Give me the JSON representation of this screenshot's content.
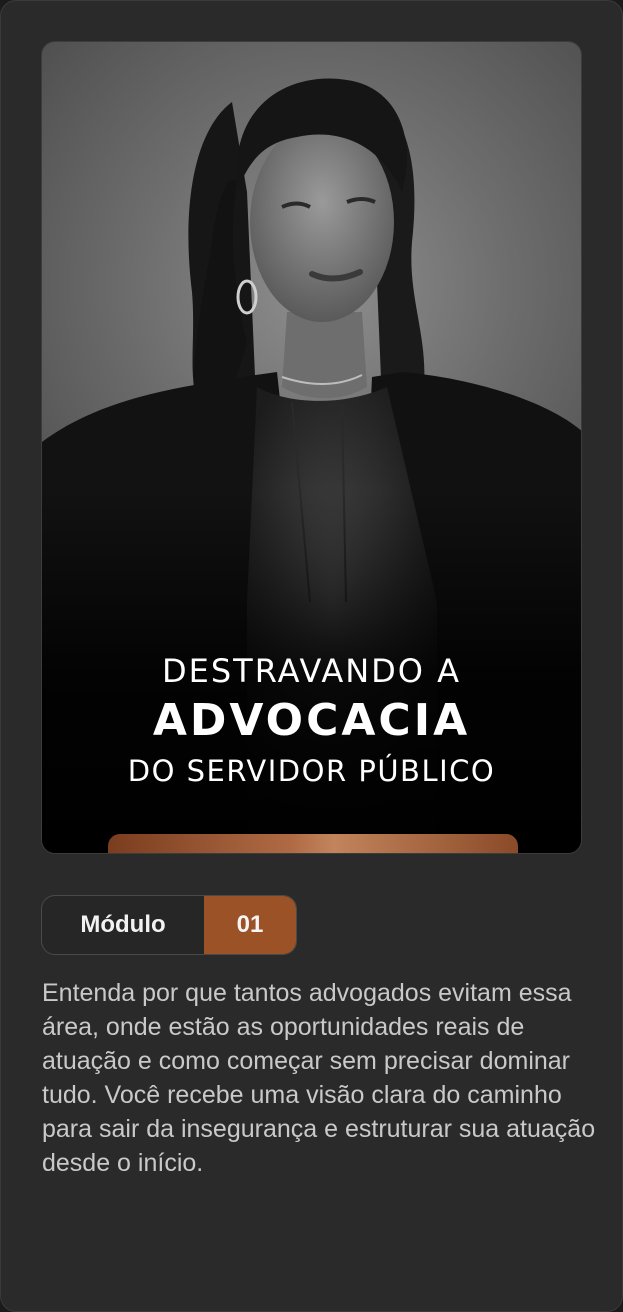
{
  "card": {
    "image_alt": "Portrait of a woman in a black blazer, black and white photo",
    "title": {
      "line1": "DESTRAVANDO A",
      "line2": "ADVOCACIA",
      "line3": "DO SERVIDOR PÚBLICO"
    },
    "module": {
      "label": "Módulo",
      "number": "01"
    },
    "description": "Entenda por que tantos advogados evitam essa área, onde estão as oportunidades reais de atuação e como começar sem precisar dominar tudo. Você recebe uma visão clara do caminho para sair da insegurança e estruturar sua atuação desde o início."
  },
  "colors": {
    "card_background": "#2a2a2a",
    "accent_bronze": "#9c5227",
    "text_primary": "#ffffff",
    "text_secondary": "#c9c9c9"
  }
}
